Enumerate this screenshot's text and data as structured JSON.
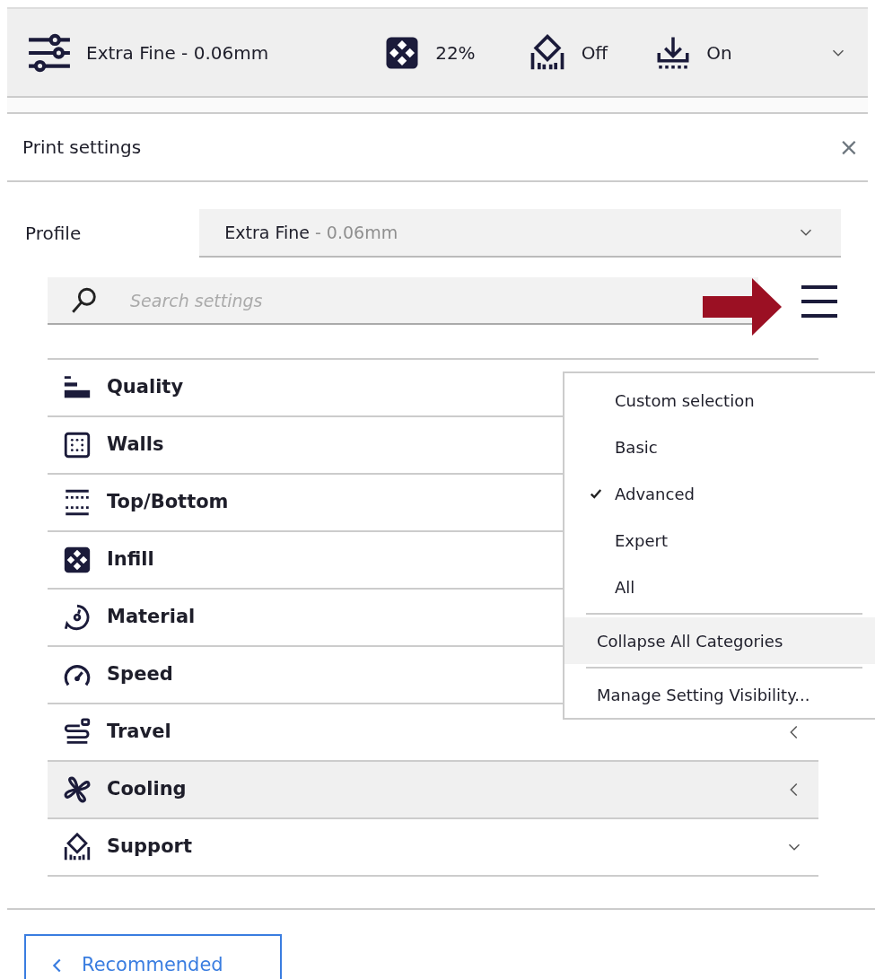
{
  "toolbar": {
    "profile": "Extra Fine - 0.06mm",
    "infill": "22%",
    "support": "Off",
    "adhesion": "On"
  },
  "panel": {
    "title": "Print settings",
    "close": "×"
  },
  "profile": {
    "label": "Profile",
    "name": "Extra Fine",
    "detail": " - 0.06mm"
  },
  "search": {
    "placeholder": "Search settings"
  },
  "categories": [
    {
      "label": "Quality",
      "kind": "quality",
      "highlighted": false
    },
    {
      "label": "Walls",
      "kind": "walls",
      "highlighted": false
    },
    {
      "label": "Top/Bottom",
      "kind": "topbottom",
      "highlighted": false
    },
    {
      "label": "Infill",
      "kind": "infill",
      "highlighted": false
    },
    {
      "label": "Material",
      "kind": "material",
      "highlighted": false
    },
    {
      "label": "Speed",
      "kind": "speed",
      "highlighted": false
    },
    {
      "label": "Travel",
      "kind": "travel",
      "highlighted": false,
      "expanded": false
    },
    {
      "label": "Cooling",
      "kind": "cooling",
      "highlighted": true,
      "expanded": false
    },
    {
      "label": "Support",
      "kind": "support",
      "highlighted": false,
      "expanded": true
    }
  ],
  "menu": [
    {
      "kind": "option",
      "label": "Custom selection",
      "selected": false
    },
    {
      "kind": "option",
      "label": "Basic",
      "selected": false
    },
    {
      "kind": "option",
      "label": "Advanced",
      "selected": true
    },
    {
      "kind": "option",
      "label": "Expert",
      "selected": false
    },
    {
      "kind": "option",
      "label": "All",
      "selected": false
    },
    {
      "kind": "separator"
    },
    {
      "kind": "action",
      "label": "Collapse All Categories",
      "highlighted": true
    },
    {
      "kind": "separator"
    },
    {
      "kind": "action",
      "label": "Manage Setting Visibility...",
      "highlighted": false
    }
  ],
  "footer": {
    "button": "Recommended"
  }
}
